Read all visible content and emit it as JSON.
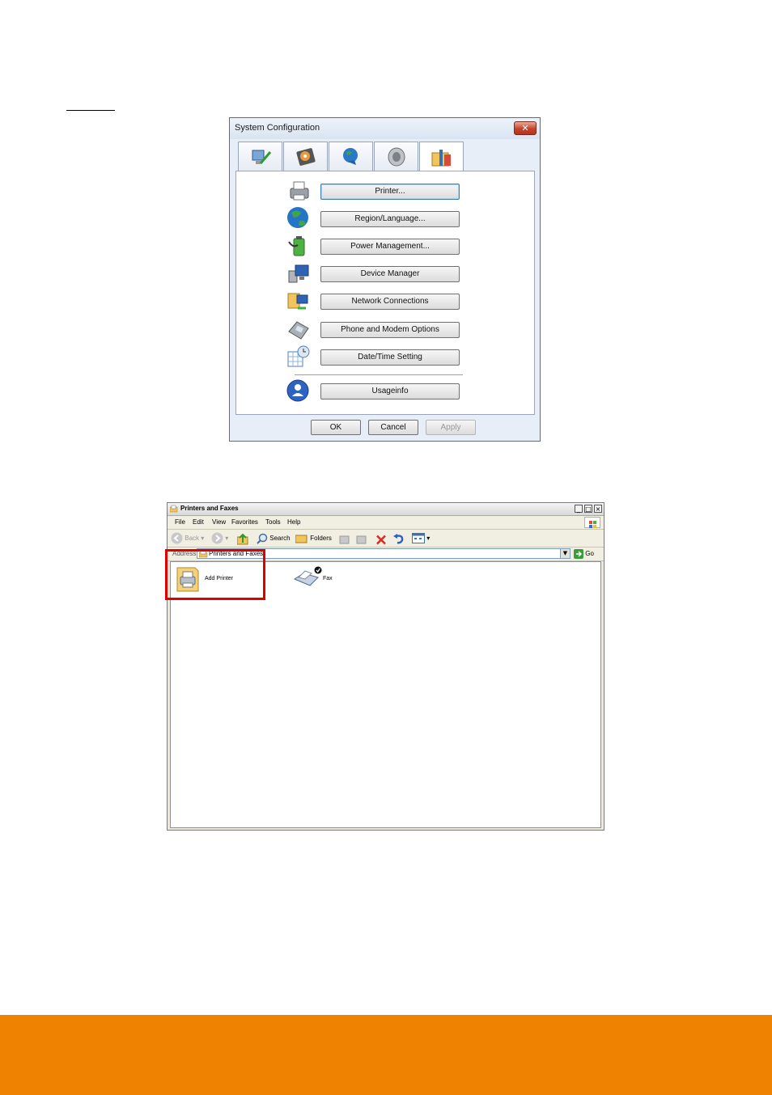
{
  "system_config": {
    "title": "System Configuration",
    "close_label": "✕",
    "tabs": [
      {
        "icon": "monitor-pen-icon"
      },
      {
        "icon": "hard-disk-icon"
      },
      {
        "icon": "globe-network-icon"
      },
      {
        "icon": "speaker-icon"
      },
      {
        "icon": "tools-folder-icon"
      }
    ],
    "items": [
      {
        "label": "Printer...",
        "icon": "printer-icon"
      },
      {
        "label": "Region/Language...",
        "icon": "globe-icon"
      },
      {
        "label": "Power Management...",
        "icon": "battery-icon"
      },
      {
        "label": "Device Manager",
        "icon": "computer-icon"
      },
      {
        "label": "Network Connections",
        "icon": "network-folder-icon"
      },
      {
        "label": "Phone and Modem Options",
        "icon": "telephone-icon"
      },
      {
        "label": "Date/Time Setting",
        "icon": "calendar-clock-icon"
      },
      {
        "label": "Usageinfo",
        "icon": "user-icon"
      }
    ],
    "buttons": {
      "ok": "OK",
      "cancel": "Cancel",
      "apply": "Apply"
    }
  },
  "printers_window": {
    "title": "Printers and Faxes",
    "menu": [
      "File",
      "Edit",
      "View",
      "Favorites",
      "Tools",
      "Help"
    ],
    "toolbar": {
      "back": "Back",
      "search": "Search",
      "folders": "Folders"
    },
    "address_label": "Address",
    "address_value": "Printers and Faxes",
    "go_label": "Go",
    "items": [
      {
        "label": "Add Printer",
        "icon": "add-printer-icon"
      },
      {
        "label": "Fax",
        "icon": "fax-icon"
      }
    ]
  },
  "colors": {
    "accent_footer": "#ef8200",
    "highlight": "#e00000"
  }
}
